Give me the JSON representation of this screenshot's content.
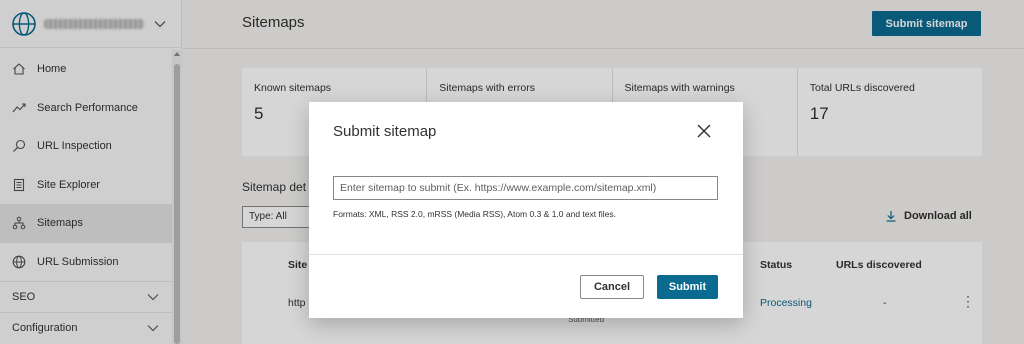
{
  "colors": {
    "accent": "#0b6a8f",
    "processing": "#0b6a8f",
    "overlay": "rgba(0,0,0,0.16)"
  },
  "sidebar": {
    "site_icon": "globe-icon",
    "items": [
      {
        "label": "Home",
        "icon": "home-icon"
      },
      {
        "label": "Search Performance",
        "icon": "trend-icon"
      },
      {
        "label": "URL Inspection",
        "icon": "search-icon"
      },
      {
        "label": "Site Explorer",
        "icon": "document-icon"
      },
      {
        "label": "Sitemaps",
        "icon": "sitemap-icon",
        "active": true
      },
      {
        "label": "URL Submission",
        "icon": "globe-icon"
      }
    ],
    "groups": [
      {
        "label": "SEO"
      },
      {
        "label": "Configuration"
      }
    ]
  },
  "header": {
    "title": "Sitemaps",
    "submit_label": "Submit sitemap"
  },
  "stats": [
    {
      "label": "Known sitemaps",
      "value": "5"
    },
    {
      "label": "Sitemaps with errors",
      "value": ""
    },
    {
      "label": "Sitemaps with warnings",
      "value": ""
    },
    {
      "label": "Total URLs discovered",
      "value": "17"
    }
  ],
  "details": {
    "title": "Sitemap det",
    "type_filter": "Type: All",
    "download_label": "Download all"
  },
  "table": {
    "columns": {
      "sitemap": "Site",
      "status": "Status",
      "urls": "URLs discovered"
    },
    "rows": [
      {
        "sitemap": "http",
        "submitted": "Submitted",
        "status": "Processing",
        "urls": "-"
      }
    ]
  },
  "modal": {
    "title": "Submit sitemap",
    "input_placeholder": "Enter sitemap to submit (Ex. https://www.example.com/sitemap.xml)",
    "input_value": "",
    "format_hint": "Formats: XML, RSS 2.0, mRSS (Media RSS), Atom 0.3 & 1.0 and text files.",
    "cancel_label": "Cancel",
    "submit_label": "Submit"
  }
}
